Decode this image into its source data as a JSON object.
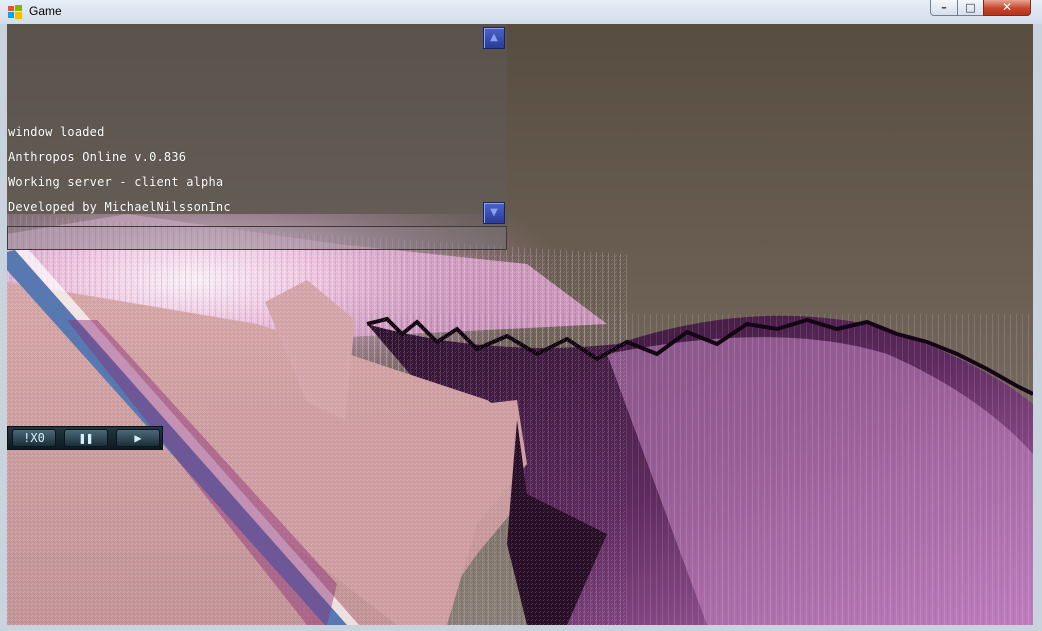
{
  "window": {
    "title": "Game",
    "minimize_glyph": "–",
    "maximize_glyph": "□",
    "close_glyph": "✕"
  },
  "console": {
    "scroll_up_glyph": "▲",
    "scroll_down_glyph": "▼",
    "lines": [
      "window loaded",
      "Anthropos Online v.0.836",
      "Working server - client alpha",
      "Developed by MichaelNilssonInc"
    ],
    "input_value": ""
  },
  "speed_controls": {
    "speed_label": "!X0",
    "pause_glyph": "❚❚",
    "play_glyph": "▶"
  },
  "icons": [
    "windows-logo-icon",
    "scroll-up-icon",
    "scroll-down-icon",
    "pause-icon",
    "play-icon"
  ]
}
